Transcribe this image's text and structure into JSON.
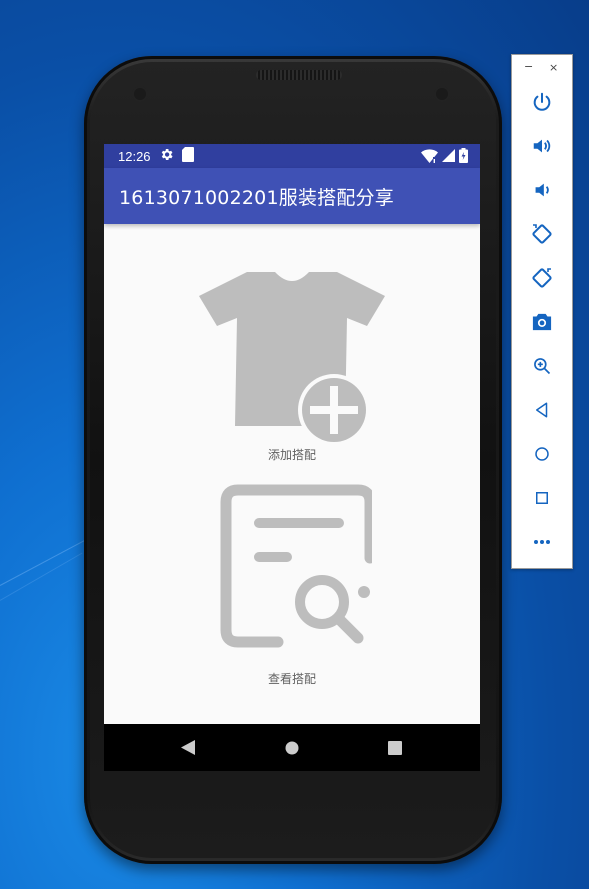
{
  "status_bar": {
    "time": "12:26"
  },
  "app_bar": {
    "title": "1613071002201服装搭配分享"
  },
  "actions": {
    "add": {
      "label": "添加搭配"
    },
    "view": {
      "label": "查看搭配"
    }
  },
  "emulator_toolbar": {
    "minimize": "−",
    "close": "×",
    "buttons": [
      "power-icon",
      "volume-up-icon",
      "volume-down-icon",
      "rotate-left-icon",
      "rotate-right-icon",
      "camera-icon",
      "zoom-icon",
      "back-icon",
      "home-icon",
      "overview-icon",
      "more-icon"
    ]
  },
  "colors": {
    "status_bar": "#303f9f",
    "app_bar": "#3f51b5",
    "screen_bg": "#fafafa",
    "icon_gray": "#bdbdbd",
    "toolbar_icon": "#1565c0"
  }
}
